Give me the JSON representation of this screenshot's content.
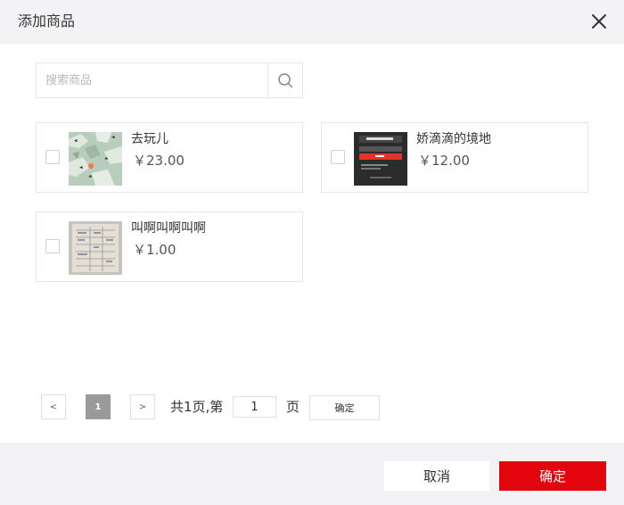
{
  "dialog": {
    "title": "添加商品",
    "close_icon": "close-icon"
  },
  "search": {
    "placeholder": "搜索商品",
    "value": "",
    "icon": "search-icon"
  },
  "products": [
    {
      "name": "去玩儿",
      "price": "￥23.00",
      "checked": false,
      "thumb": "map-thumbnail"
    },
    {
      "name": "娇滴滴的境地",
      "price": "￥12.00",
      "checked": false,
      "thumb": "app-screenshot-thumbnail"
    },
    {
      "name": "叫啊叫啊叫啊",
      "price": "￥1.00",
      "checked": false,
      "thumb": "document-photo-thumbnail"
    }
  ],
  "pagination": {
    "prev": "<",
    "current": "1",
    "next": ">",
    "total_text": "共1页,第",
    "page_input": "1",
    "page_suffix": "页",
    "confirm": "确定"
  },
  "footer": {
    "cancel": "取消",
    "confirm": "确定"
  },
  "colors": {
    "accent": "#e4050c",
    "header_bg": "#f3f3f5",
    "border": "#e5e5e5"
  }
}
